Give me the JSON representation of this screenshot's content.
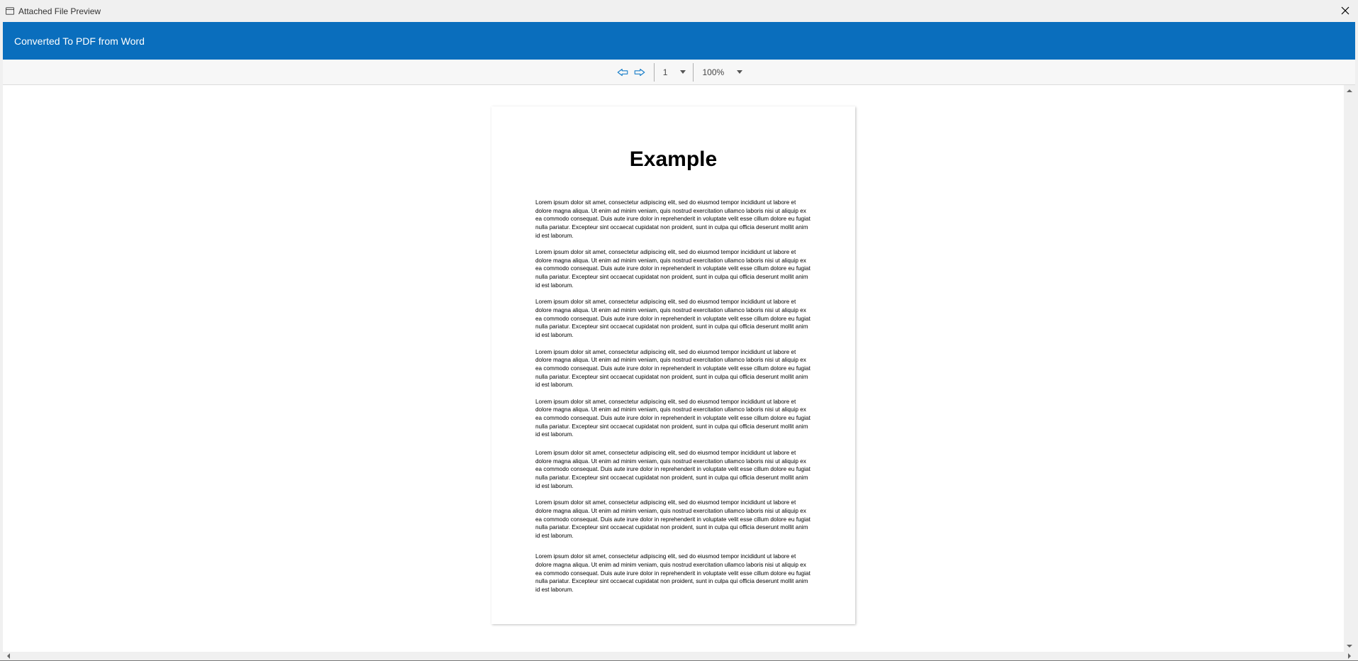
{
  "window": {
    "title": "Attached File Preview"
  },
  "header": {
    "title": "Converted To PDF from Word"
  },
  "toolbar": {
    "page_value": "1",
    "zoom_value": "100%"
  },
  "document": {
    "heading": "Example",
    "paragraph_text": "Lorem ipsum dolor sit amet, consectetur adipiscing elit, sed do eiusmod tempor incididunt ut labore et dolore magna aliqua. Ut enim ad minim veniam, quis nostrud exercitation ullamco laboris nisi ut aliquip ex ea commodo consequat. Duis aute irure dolor in reprehenderit in voluptate velit esse cillum dolore eu fugiat nulla pariatur. Excepteur sint occaecat cupidatat non proident, sunt in culpa qui officia deserunt mollit anim id est laborum."
  }
}
